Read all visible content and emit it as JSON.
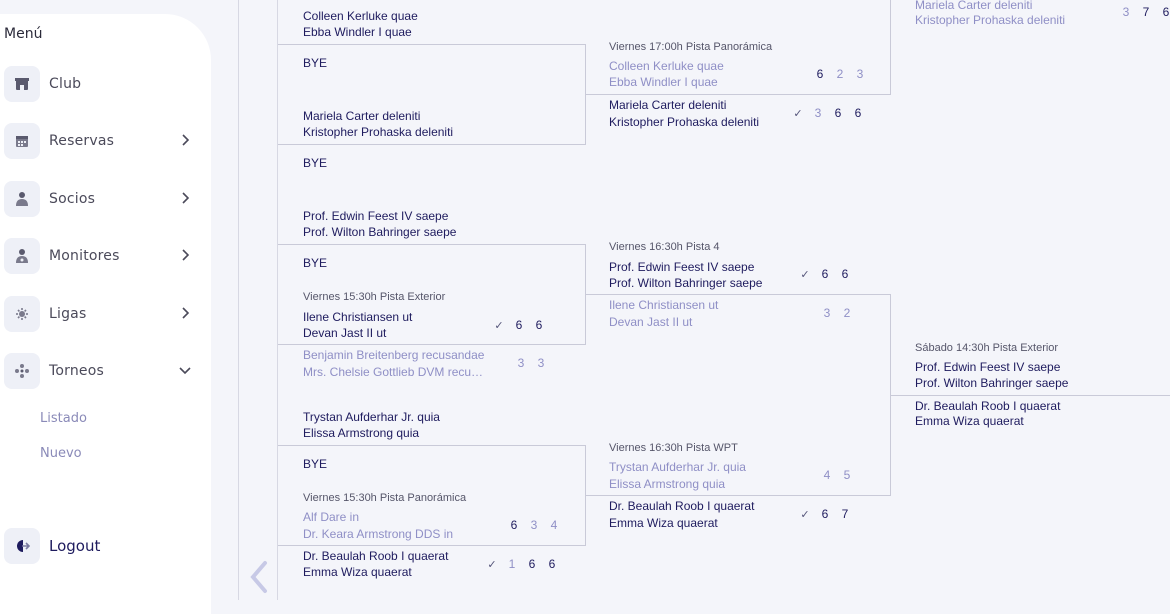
{
  "sidebar": {
    "title": "Menú",
    "items": [
      {
        "label": "Club",
        "icon": "store-icon"
      },
      {
        "label": "Reservas",
        "icon": "calendar-icon"
      },
      {
        "label": "Socios",
        "icon": "user-icon"
      },
      {
        "label": "Monitores",
        "icon": "trainer-icon"
      },
      {
        "label": "Ligas",
        "icon": "trophy-icon"
      },
      {
        "label": "Torneos",
        "icon": "group-icon"
      }
    ],
    "subitems": [
      "Listado",
      "Nuevo"
    ],
    "logout": "Logout"
  },
  "bracket": {
    "round1": [
      {
        "team1": "Colleen Kerluke quae",
        "team2": "Ebba Windler I quae"
      },
      {
        "bye": "BYE"
      },
      {
        "team1": "Mariela Carter deleniti",
        "team2": "Kristopher Prohaska deleniti"
      },
      {
        "bye": "BYE"
      },
      {
        "team1": "Prof. Edwin Feest IV saepe",
        "team2": "Prof. Wilton Bahringer saepe"
      },
      {
        "bye": "BYE"
      },
      {
        "info": "Viernes 15:30h Pista Exterior",
        "a1": "Ilene Christiansen ut",
        "a2": "Devan Jast II ut",
        "a_scores": [
          "6",
          "6"
        ],
        "b1": "Benjamin Breitenberg recusandae",
        "b2": "Mrs. Chelsie Gottlieb DVM recu…",
        "b_scores": [
          "3",
          "3"
        ]
      },
      {
        "team1": "Trystan Aufderhar Jr. quia",
        "team2": "Elissa Armstrong quia"
      },
      {
        "bye": "BYE"
      },
      {
        "info": "Viernes 15:30h Pista Panorámica",
        "a1": "Alf Dare in",
        "a2": "Dr. Keara Armstrong DDS in",
        "a_scores": [
          "6",
          "3",
          "4"
        ],
        "b1": "Dr. Beaulah Roob I quaerat",
        "b2": "Emma Wiza quaerat",
        "b_scores": [
          "1",
          "6",
          "6"
        ]
      }
    ],
    "round2": [
      {
        "info": "Viernes 17:00h Pista Panorámica",
        "a1": "Colleen Kerluke quae",
        "a2": "Ebba Windler I quae",
        "a_scores": [
          "6",
          "2",
          "3"
        ],
        "b1": "Mariela Carter deleniti",
        "b2": "Kristopher Prohaska deleniti",
        "b_scores": [
          "3",
          "6",
          "6"
        ]
      },
      {
        "info": "Viernes 16:30h Pista 4",
        "a1": "Prof. Edwin Feest IV saepe",
        "a2": "Prof. Wilton Bahringer saepe",
        "a_scores": [
          "6",
          "6"
        ],
        "b1": "Ilene Christiansen ut",
        "b2": "Devan Jast II ut",
        "b_scores": [
          "3",
          "2"
        ]
      },
      {
        "info": "Viernes 16:30h Pista WPT",
        "a1": "Trystan Aufderhar Jr. quia",
        "a2": "Elissa Armstrong quia",
        "a_scores": [
          "4",
          "5"
        ],
        "b1": "Dr. Beaulah Roob I quaerat",
        "b2": "Emma Wiza quaerat",
        "b_scores": [
          "6",
          "7"
        ]
      }
    ],
    "round3": [
      {
        "a1": "Mariela Carter deleniti",
        "a2": "Kristopher Prohaska deleniti",
        "a_scores": [
          "3",
          "7",
          "6"
        ]
      },
      {
        "info": "Sábado 14:30h Pista Exterior",
        "a1": "Prof. Edwin Feest IV saepe",
        "a2": "Prof. Wilton Bahringer saepe",
        "b1": "Dr. Beaulah Roob I quaerat",
        "b2": "Emma Wiza quaerat"
      }
    ],
    "check_symbol": "✓"
  },
  "colors": {
    "primary": "#1e1b5e",
    "muted": "#8f8fc6",
    "line": "#c9cad8",
    "bg": "#f4f5fa"
  }
}
